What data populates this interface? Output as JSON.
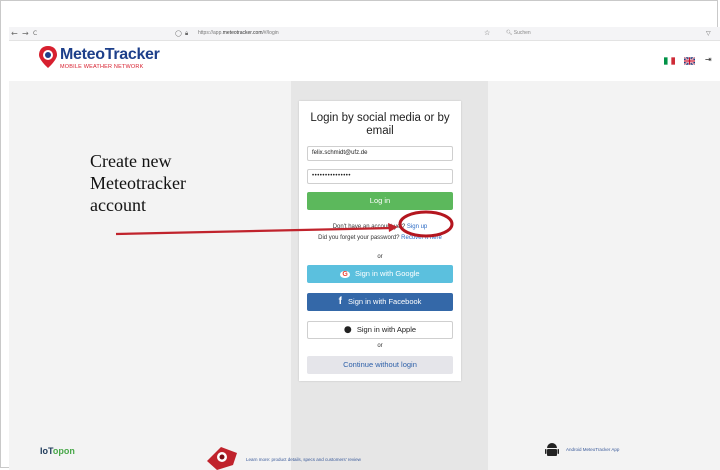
{
  "browser": {
    "back": "←",
    "forward": "→",
    "reload": "C",
    "url_prefix": "https://app.",
    "url_domain": "meteotracker.com",
    "url_path": "/#/login",
    "search_placeholder": "Suchen"
  },
  "header": {
    "logo_title": "MeteoTracker",
    "logo_subtitle": "MOBILE WEATHER NETWORK",
    "lang_italian": "Italian",
    "lang_english": "English"
  },
  "login": {
    "title": "Login by social media or by email",
    "email_value": "felix.schmidt@ufz.de",
    "password_value": "•••••••••••••••",
    "login_button": "Log in",
    "no_account_text": "Don't have an account yet?",
    "signup_link": "Sign up",
    "forgot_text": "Did you forget your password?",
    "recover_link": "Recover it here",
    "or_1": "or",
    "google_button": "Sign in with Google",
    "facebook_button": "Sign in with Facebook",
    "apple_button": "Sign in with Apple",
    "or_2": "or",
    "continue_button": "Continue without login"
  },
  "annotation": {
    "line1": "Create new",
    "line2": "Meteotracker",
    "line3": "account"
  },
  "footer": {
    "iotopon_a": "IoT",
    "iotopon_b": "opon",
    "learn_more": "Learn more: product details, specs and customers' review",
    "android_app": "Android MeteoTracker App"
  },
  "colors": {
    "login_green": "#5cb85c",
    "google_blue": "#5bc0de",
    "facebook_blue": "#3468a8",
    "annotation_red": "#c0232c"
  }
}
